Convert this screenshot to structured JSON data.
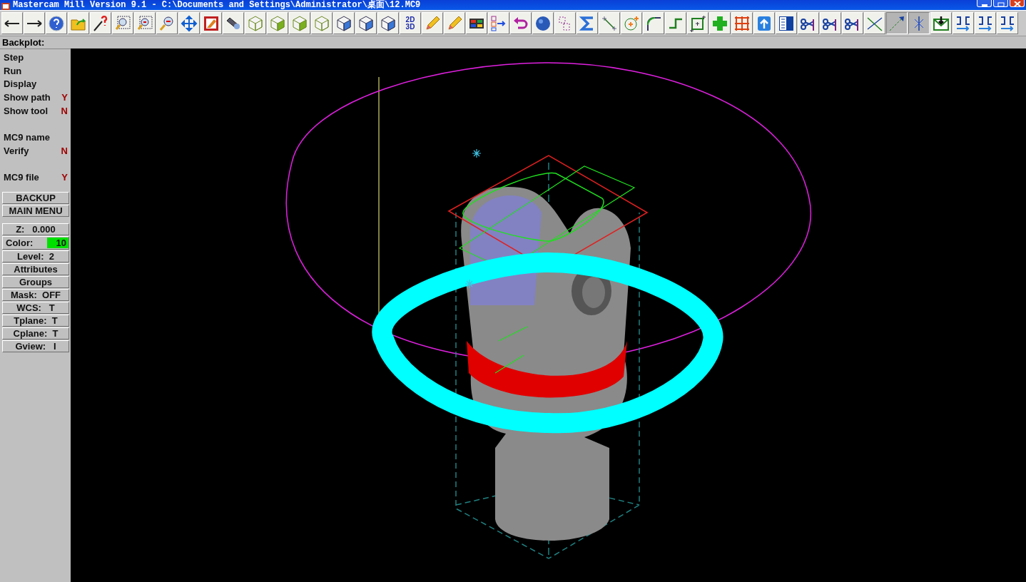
{
  "window": {
    "title": "Mastercam Mill Version 9.1 - C:\\Documents and Settings\\Administrator\\桌面\\12.MC9"
  },
  "toolbar": [
    {
      "pressed": false
    },
    {
      "pressed": false
    },
    {
      "pressed": false
    },
    {
      "pressed": false
    },
    {
      "pressed": false
    },
    {
      "pressed": false
    },
    {
      "pressed": false
    },
    {
      "pressed": false
    },
    {
      "pressed": false
    },
    {
      "pressed": false
    },
    {
      "pressed": false
    },
    {
      "pressed": false
    },
    {
      "pressed": false
    },
    {
      "pressed": false
    },
    {
      "pressed": false
    },
    {
      "pressed": false
    },
    {
      "pressed": false
    },
    {
      "pressed": false
    },
    {
      "pressed": false,
      "label": [
        "2D",
        "3D"
      ]
    },
    {
      "pressed": false
    },
    {
      "pressed": false
    },
    {
      "pressed": false
    },
    {
      "pressed": false
    },
    {
      "pressed": false
    },
    {
      "pressed": false
    },
    {
      "pressed": false
    },
    {
      "pressed": false
    },
    {
      "pressed": false
    },
    {
      "pressed": false
    },
    {
      "pressed": false
    },
    {
      "pressed": false
    },
    {
      "pressed": false
    },
    {
      "pressed": false
    },
    {
      "pressed": false
    },
    {
      "pressed": false
    },
    {
      "pressed": false
    },
    {
      "pressed": false
    },
    {
      "pressed": false
    },
    {
      "pressed": false
    },
    {
      "pressed": false
    },
    {
      "pressed": true
    },
    {
      "pressed": true
    },
    {
      "pressed": false
    },
    {
      "pressed": false
    },
    {
      "pressed": false
    },
    {
      "pressed": false
    }
  ],
  "prompt": "Backplot:",
  "menu_groups": [
    [
      {
        "label": "Step"
      },
      {
        "label": "Run"
      },
      {
        "label": "Display"
      },
      {
        "label": "Show path",
        "value": "Y"
      },
      {
        "label": "Show tool",
        "value": "N"
      }
    ],
    [
      {
        "label": "MC9 name"
      },
      {
        "label": "Verify",
        "value": "N"
      }
    ],
    [
      {
        "label": "MC9 file",
        "value": "Y"
      }
    ]
  ],
  "nav_buttons": [
    "BACKUP",
    "MAIN MENU"
  ],
  "status": [
    {
      "kind": "text",
      "label": "Z:   0.000"
    },
    {
      "kind": "color",
      "label": "Color:",
      "value": "10",
      "color": "#00e000"
    },
    {
      "kind": "text",
      "label": "Level:  2"
    },
    {
      "kind": "text",
      "label": "Attributes"
    },
    {
      "kind": "text",
      "label": "Groups"
    },
    {
      "kind": "text",
      "label": "Mask:  OFF"
    },
    {
      "kind": "text",
      "label": "WCS:   T"
    },
    {
      "kind": "text",
      "label": "Tplane:  T"
    },
    {
      "kind": "text",
      "label": "Cplane:  T"
    },
    {
      "kind": "text",
      "label": "Gview:   I"
    }
  ]
}
